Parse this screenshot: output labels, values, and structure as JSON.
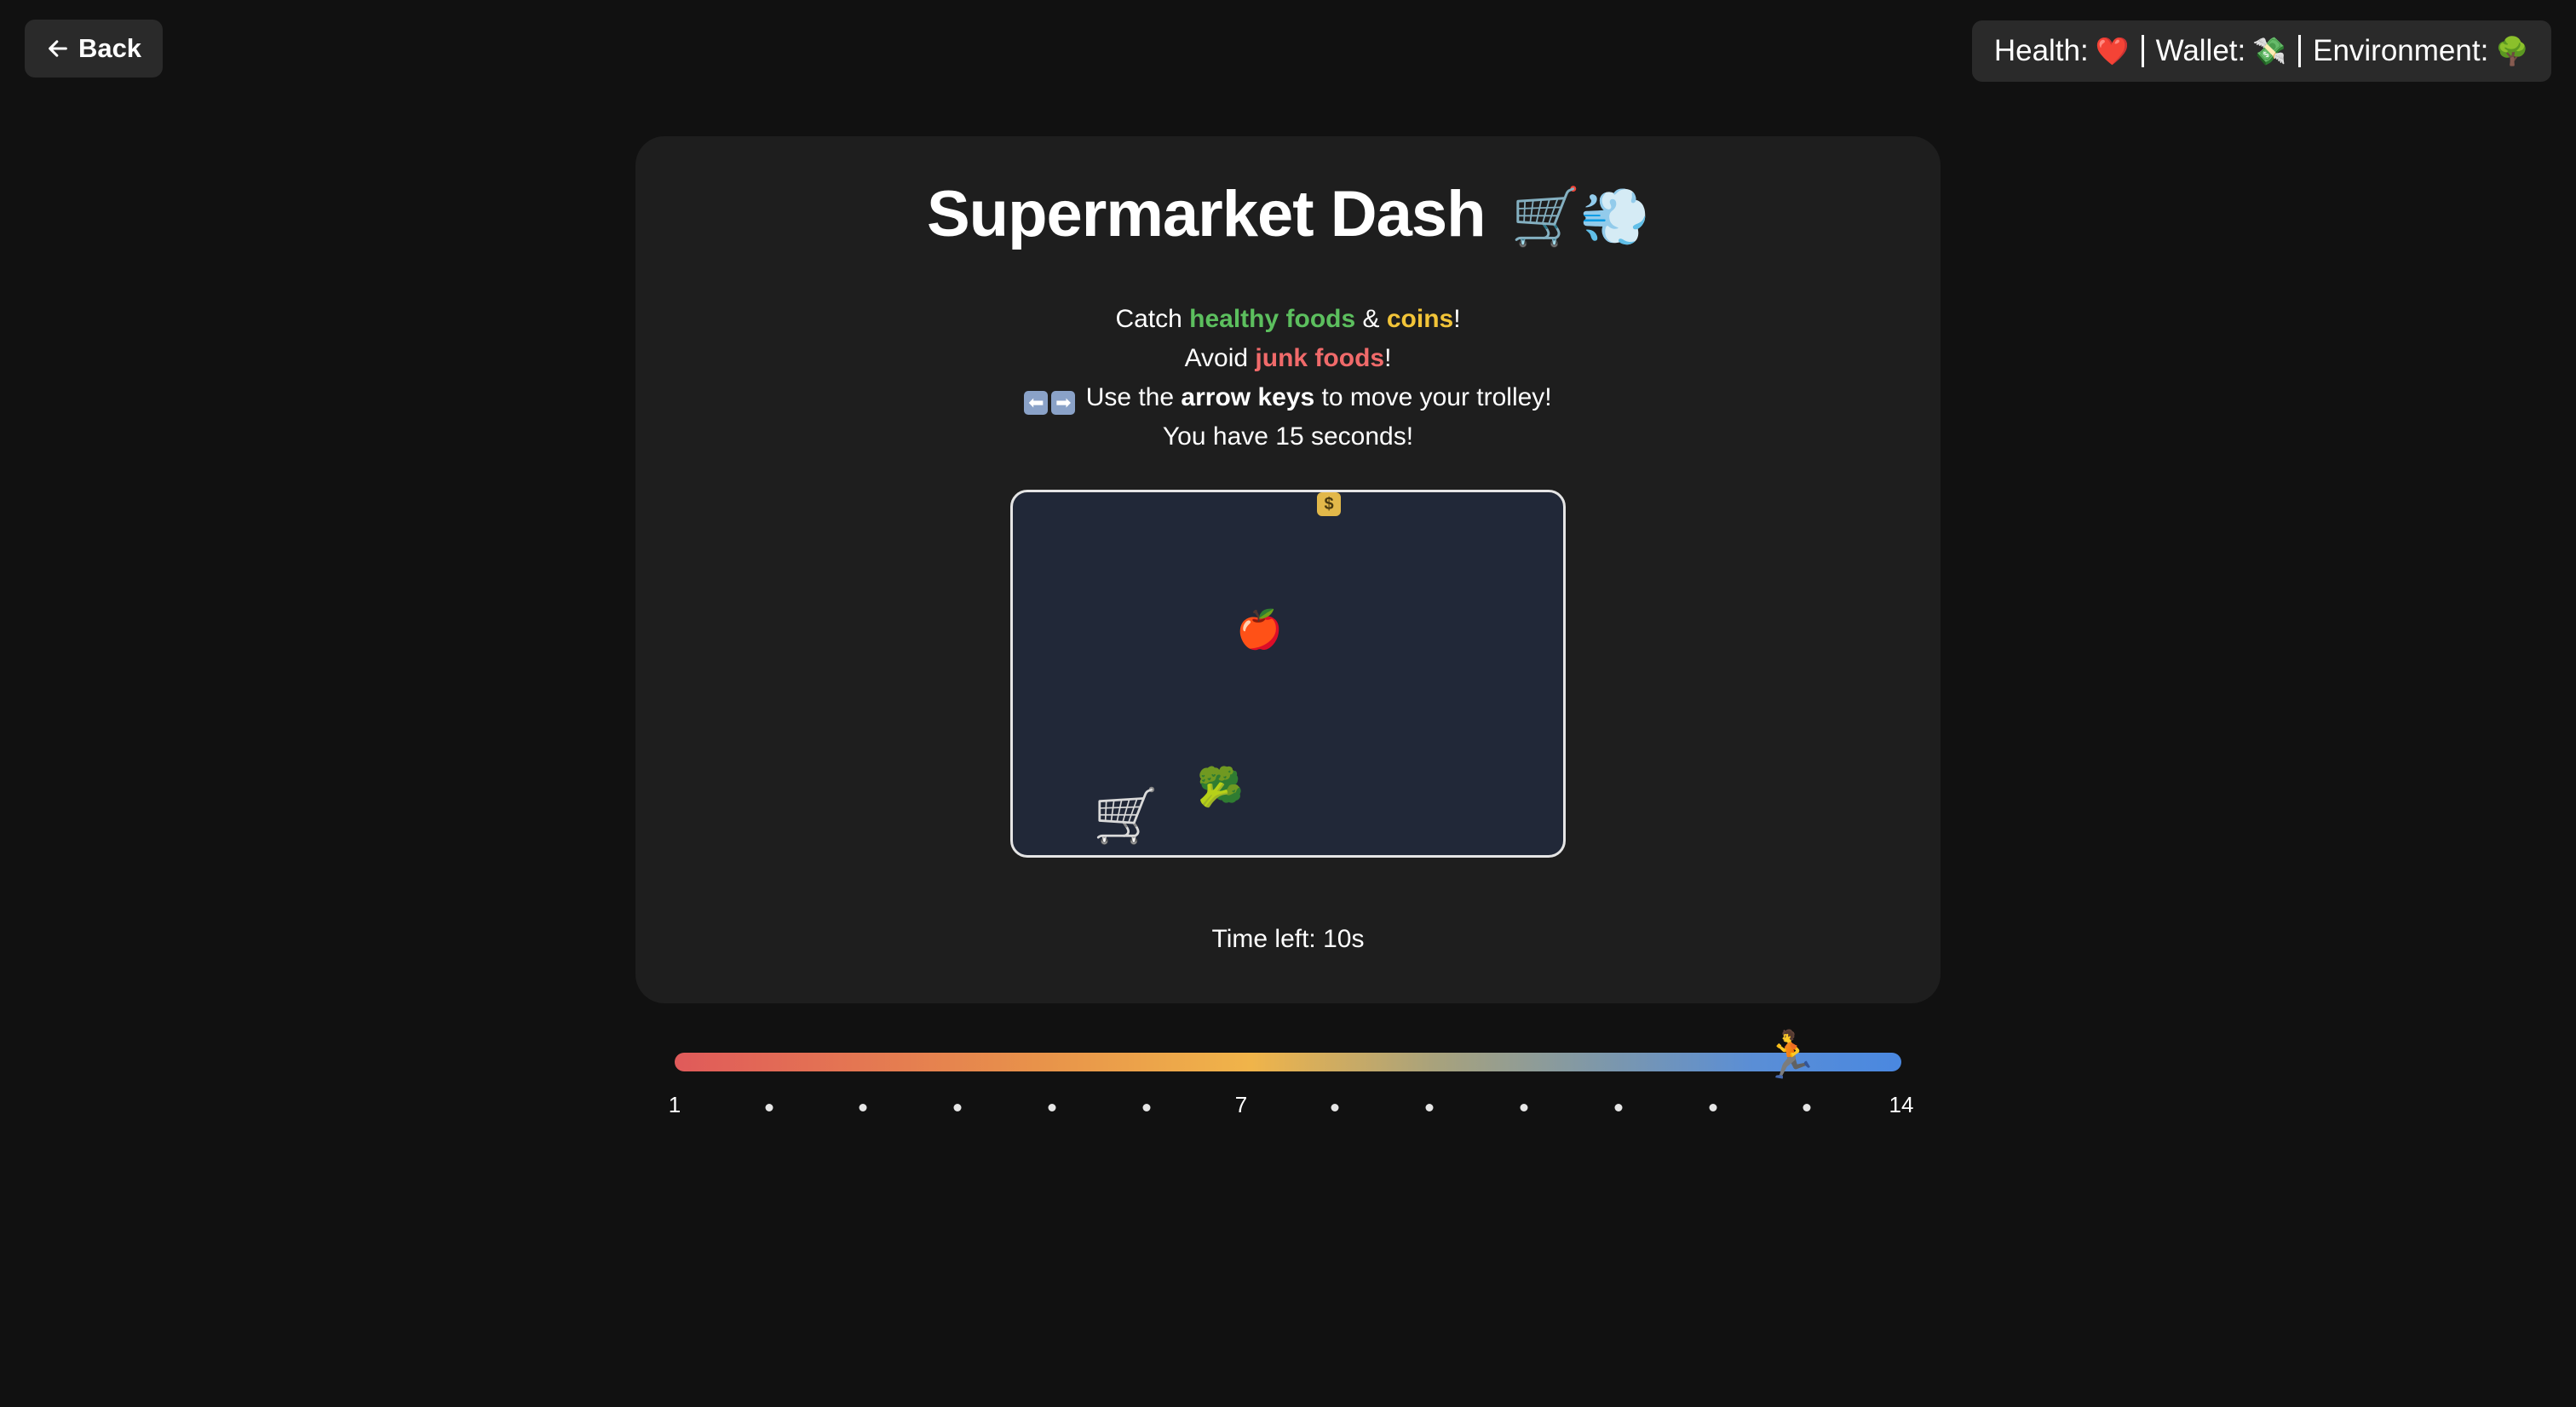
{
  "back_button": {
    "label": "Back"
  },
  "status": {
    "health_label": "Health:",
    "health_emoji": "❤️",
    "wallet_label": "Wallet:",
    "wallet_emoji": "💸",
    "environment_label": "Environment:",
    "environment_emoji": "🌳"
  },
  "game": {
    "title": "Supermarket Dash",
    "title_emoji": "🛒💨",
    "instructions": {
      "line1_prefix": "Catch ",
      "line1_healthy": "healthy foods",
      "line1_amp": " & ",
      "line1_coins": "coins",
      "line1_suffix": "!",
      "line2_prefix": "Avoid ",
      "line2_junk": "junk foods",
      "line2_suffix": "!",
      "line3_left_key": "⬅",
      "line3_right_key": "➡",
      "line3_prefix": " Use the ",
      "line3_bold": "arrow keys",
      "line3_suffix": " to move your trolley!",
      "line4": "You have 15 seconds!"
    },
    "items": {
      "coin": "$",
      "apple": "🍎",
      "broccoli": "🥦",
      "trolley": "🛒"
    },
    "time_left": "Time left: 10s"
  },
  "progress": {
    "min_label": "1",
    "mid_label": "7",
    "max_label": "14",
    "current_step": 13,
    "total_steps": 14,
    "runner_emoji": "🏃"
  },
  "colors": {
    "healthy": "#5cbf5e",
    "coins": "#f2c438",
    "junk": "#f06a6a",
    "game_bg": "#212838"
  }
}
